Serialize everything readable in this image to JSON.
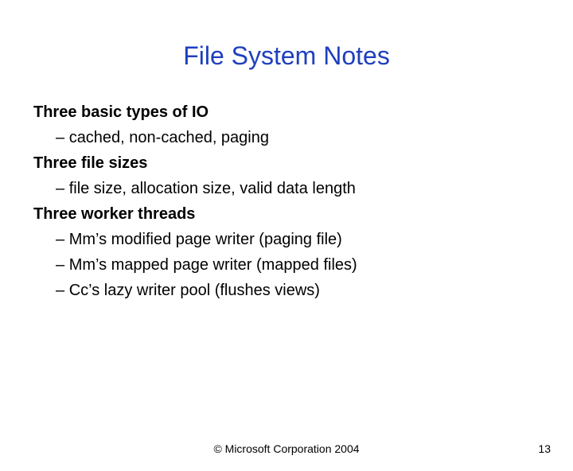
{
  "title": "File System Notes",
  "sections": [
    {
      "head": "Three basic types of IO",
      "items": [
        "cached, non-cached, paging"
      ]
    },
    {
      "head": "Three file sizes",
      "items": [
        "file size, allocation size, valid data length"
      ]
    },
    {
      "head": "Three worker threads",
      "items": [
        "Mm’s modified page writer (paging file)",
        "Mm’s mapped page writer (mapped files)",
        "Cc’s lazy writer pool (flushes views)"
      ]
    }
  ],
  "footer": {
    "copyright": "© Microsoft Corporation 2004",
    "page": "13"
  },
  "dash": "–  "
}
